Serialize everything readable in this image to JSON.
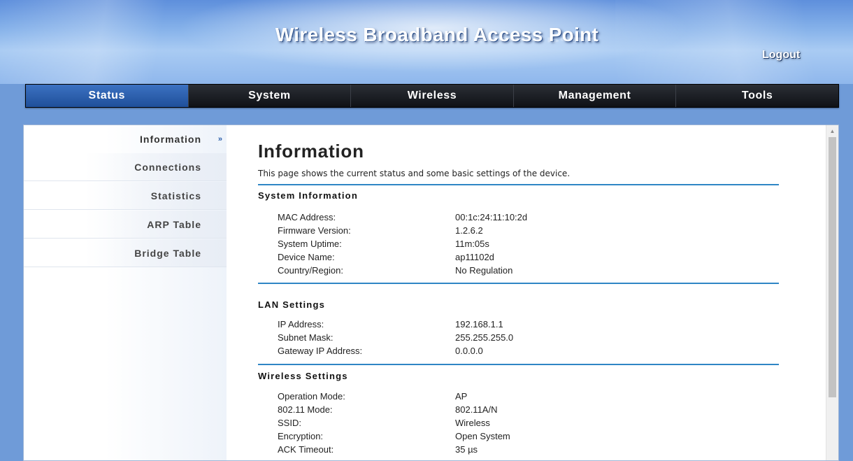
{
  "header": {
    "title": "Wireless Broadband Access Point",
    "logout": "Logout"
  },
  "nav": {
    "tabs": [
      {
        "label": "Status",
        "active": true
      },
      {
        "label": "System",
        "active": false
      },
      {
        "label": "Wireless",
        "active": false
      },
      {
        "label": "Management",
        "active": false
      },
      {
        "label": "Tools",
        "active": false
      }
    ]
  },
  "sidebar": {
    "items": [
      {
        "label": "Information",
        "active": true
      },
      {
        "label": "Connections",
        "active": false
      },
      {
        "label": "Statistics",
        "active": false
      },
      {
        "label": "ARP Table",
        "active": false
      },
      {
        "label": "Bridge Table",
        "active": false
      }
    ],
    "active_marker": "»"
  },
  "main": {
    "title": "Information",
    "description": "This page shows the current status and some basic settings of the device.",
    "sections": [
      {
        "title": "System Information",
        "rows": [
          {
            "label": "MAC Address:",
            "value": "00:1c:24:11:10:2d"
          },
          {
            "label": "Firmware Version:",
            "value": "1.2.6.2"
          },
          {
            "label": "System Uptime:",
            "value": "11m:05s"
          },
          {
            "label": "Device Name:",
            "value": "ap11102d"
          },
          {
            "label": "Country/Region:",
            "value": "No Regulation"
          }
        ]
      },
      {
        "title": "LAN Settings",
        "rows": [
          {
            "label": "IP Address:",
            "value": "192.168.1.1"
          },
          {
            "label": "Subnet Mask:",
            "value": "255.255.255.0"
          },
          {
            "label": "Gateway IP Address:",
            "value": "0.0.0.0"
          }
        ]
      },
      {
        "title": "Wireless Settings",
        "rows": [
          {
            "label": "Operation Mode:",
            "value": "AP"
          },
          {
            "label": "802.11 Mode:",
            "value": "802.11A/N"
          },
          {
            "label": "SSID:",
            "value": "Wireless"
          },
          {
            "label": "Encryption:",
            "value": "Open System"
          },
          {
            "label": "ACK Timeout:",
            "value": "35 µs"
          }
        ]
      }
    ]
  },
  "colors": {
    "accent_rule": "#2f86c5",
    "nav_active": "#2b62b0",
    "nav_bg": "#15181d"
  }
}
